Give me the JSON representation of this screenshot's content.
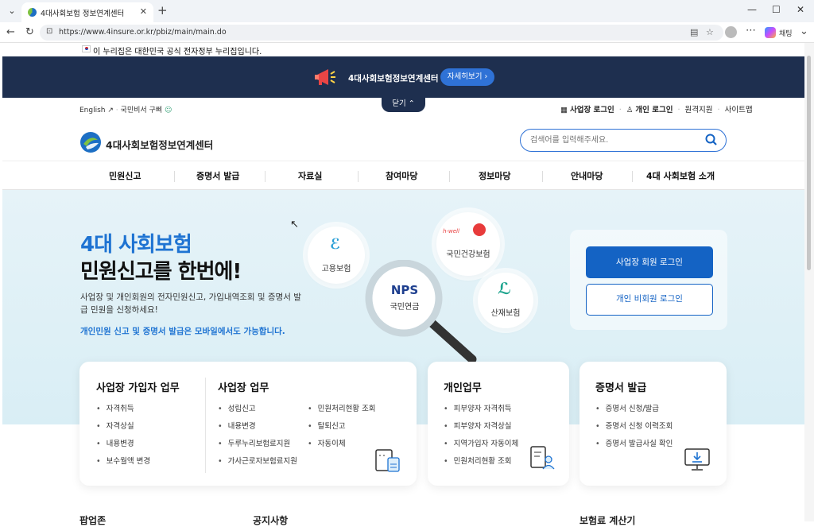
{
  "browser": {
    "tab_title": "4대사회보험 정보연계센터",
    "url": "https://www.4insure.or.kr/pbiz/main/main.do",
    "copilot_label": "채팅"
  },
  "gov_notice": "이 누리집은 대한민국 공식 전자정부 누리집입니다.",
  "banner": {
    "text": "4대사회보험정보연계센터",
    "button": "자세히보기",
    "close": "닫기"
  },
  "util": {
    "english": "English",
    "ngo": "국민비서 구삐",
    "biz_login": "사업장 로그인",
    "personal_login": "개인 로그인",
    "remote": "원격지원",
    "sitemap": "사이트맵"
  },
  "site": {
    "logo_text": "4대사회보험정보연계센터",
    "search_placeholder": "검색어를 입력해주세요."
  },
  "gnb": [
    "민원신고",
    "증명서 발급",
    "자료실",
    "참여마당",
    "정보마당",
    "안내마당",
    "4대 사회보험 소개"
  ],
  "hero": {
    "title1": "4대 사회보험",
    "title2": "민원신고를 한번에!",
    "desc": "사업장 및 개인회원의 전자민원신고, 가입내역조회 및 증명서 발급 민원을 신청하세요!",
    "mobile": "개인민원 신고 및 증명서 발급은 모바일에서도 가능합니다.",
    "insurances": {
      "employment": "고용보험",
      "health_brand": "h-well",
      "health": "국민건강보험",
      "pension_brand": "NPS",
      "pension": "국민연금",
      "industrial": "산재보험"
    },
    "login_biz": "사업장 회원 로그인",
    "login_personal": "개인 비회원 로그인"
  },
  "cards": {
    "biz_member": {
      "title": "사업장 가입자 업무",
      "items": [
        "자격취득",
        "자격상실",
        "내용변경",
        "보수월액 변경"
      ]
    },
    "biz": {
      "title": "사업장 업무",
      "col1": [
        "성립신고",
        "내용변경",
        "두루누리보험료지원",
        "가사근로자보험료지원"
      ],
      "col2": [
        "민원처리현황 조회",
        "탈퇴신고",
        "자동이체"
      ]
    },
    "personal": {
      "title": "개인업무",
      "items": [
        "피부양자 자격취득",
        "피부양자 자격상실",
        "지역가입자 자동이체",
        "민원처리현황 조회"
      ]
    },
    "certificate": {
      "title": "증명서 발급",
      "items": [
        "증명서 신청/발급",
        "증명서 신청 이력조회",
        "증명서 발급사실 확인"
      ]
    }
  },
  "bottom": [
    "팝업존",
    "공지사항",
    "보험료 계산기"
  ],
  "colors": {
    "navy": "#1e2f4f",
    "primary": "#1463c4",
    "accent_blue": "#1e73d2",
    "hero_bg": "#d9eef5"
  }
}
